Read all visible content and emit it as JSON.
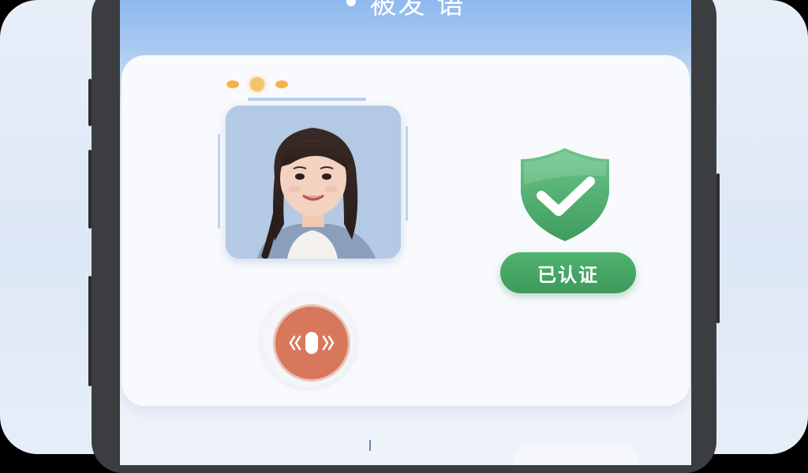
{
  "header": {
    "title": "被发 语"
  },
  "verification": {
    "status_label": "已认证"
  },
  "icons": {
    "shield": "shield-check-icon",
    "mic": "microphone-icon",
    "loader": "loading-dots-icon"
  },
  "colors": {
    "header_blue": "#8ab6ec",
    "verified_green": "#3d9a5c",
    "mic_orange": "#d7785d",
    "loader_yellow": "#f3b24a"
  }
}
